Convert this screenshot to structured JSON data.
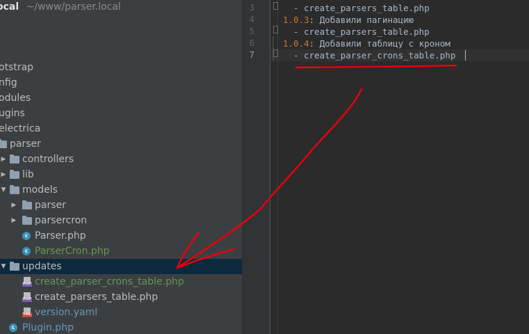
{
  "project": {
    "name": "ocal",
    "path": "~/www/parser.local"
  },
  "tree": [
    {
      "label": "otstrap",
      "kind": "folder-cut",
      "selected": false
    },
    {
      "label": "nfig",
      "kind": "folder-cut",
      "selected": false
    },
    {
      "label": "odules",
      "kind": "folder-cut",
      "selected": false
    },
    {
      "label": "ugins",
      "kind": "folder-cut",
      "selected": false
    },
    {
      "label": "electrica",
      "kind": "folder-cut",
      "selected": false
    },
    {
      "label": "parser",
      "kind": "folder",
      "selected": false
    },
    {
      "label": "controllers",
      "kind": "folder",
      "selected": false
    },
    {
      "label": "lib",
      "kind": "folder",
      "selected": false
    },
    {
      "label": "models",
      "kind": "folder",
      "selected": false
    },
    {
      "label": "parser",
      "kind": "folder",
      "selected": false
    },
    {
      "label": "parsercron",
      "kind": "folder",
      "selected": false
    },
    {
      "label": "Parser.php",
      "kind": "class",
      "selected": false
    },
    {
      "label": "ParserCron.php",
      "kind": "class",
      "selected": false
    },
    {
      "label": "updates",
      "kind": "folder",
      "selected": true
    },
    {
      "label": "create_parser_crons_table.php",
      "kind": "php",
      "selected": false
    },
    {
      "label": "create_parsers_table.php",
      "kind": "php",
      "selected": false
    },
    {
      "label": "version.yaml",
      "kind": "yml",
      "selected": false
    },
    {
      "label": "Plugin.php",
      "kind": "class",
      "selected": false
    }
  ],
  "editor": {
    "lines": [
      {
        "num": "3",
        "prefix": "",
        "text": "  - create_parsers_table.php"
      },
      {
        "num": "4",
        "prefix": "1.0.3",
        "text": ": Добавили пагинацию"
      },
      {
        "num": "5",
        "prefix": "",
        "text": "  - create_parsers_table.php"
      },
      {
        "num": "6",
        "prefix": "1.0.4",
        "text": ": Добавили таблицу с кроном"
      },
      {
        "num": "7",
        "prefix": "",
        "text": "  - create_parser_crons_table.php"
      }
    ],
    "current_line": 7
  },
  "colors": {
    "tree_bg": "#3c3f41",
    "editor_bg": "#2b2b2b",
    "selection": "#0d293e",
    "annotation": "#e8000d",
    "version_key": "#cc7832",
    "modified_file": "#629755"
  }
}
